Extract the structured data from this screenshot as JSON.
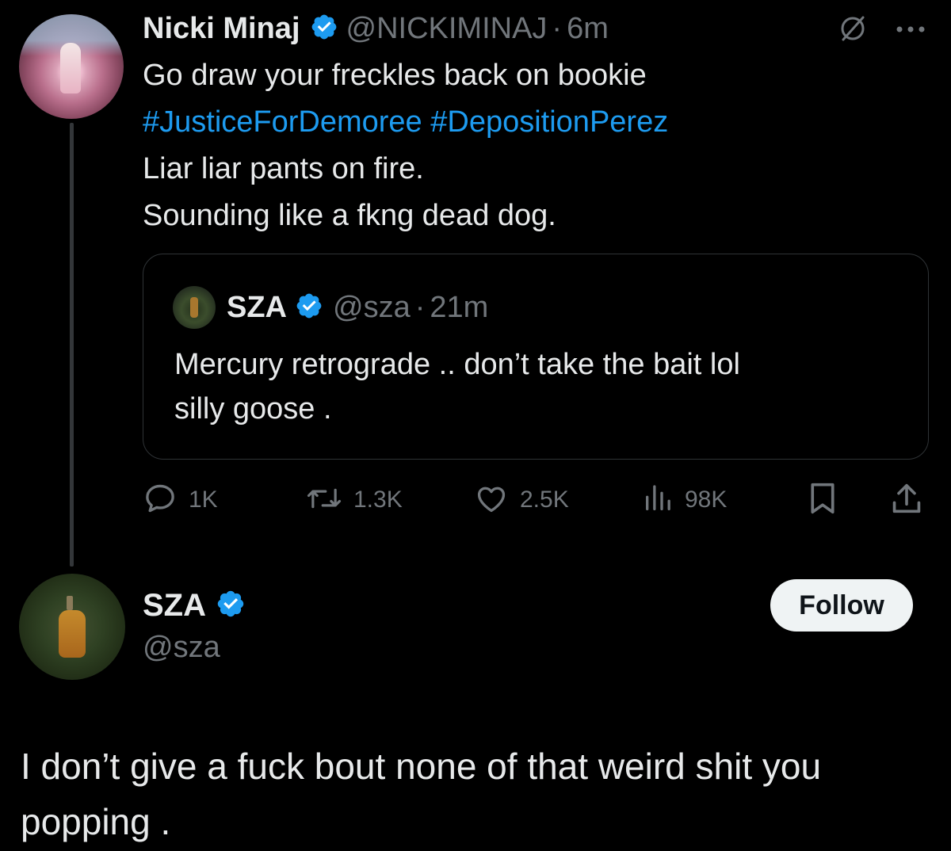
{
  "tweet": {
    "author_name": "Nicki Minaj",
    "author_handle": "@NICKIMINAJ",
    "separator": "·",
    "time": "6m",
    "text_lines": [
      "Go draw your freckles back on bookie",
      "Liar liar pants on fire.",
      "Sounding like a fkng dead dog."
    ],
    "hashtags": [
      "#JusticeForDemoree",
      "#DepositionPerez"
    ],
    "icons": [
      "grok-icon",
      "more-icon",
      "verified-badge-icon"
    ],
    "quote": {
      "author_name": "SZA",
      "author_handle": "@sza",
      "separator": "·",
      "time": "21m",
      "text_lines": [
        "Mercury retrograde .. don’t take the bait lol",
        "silly goose ."
      ]
    },
    "actions": {
      "replies": "1K",
      "reposts": "1.3K",
      "likes": "2.5K",
      "views": "98K"
    }
  },
  "reply": {
    "author_name": "SZA",
    "author_handle": "@sza",
    "follow_label": "Follow",
    "text_lines": [
      "I don’t give a fuck bout none of that weird shit you",
      "popping ."
    ]
  },
  "colors": {
    "background": "#000000",
    "text": "#e7e9ea",
    "secondary": "#71767b",
    "link": "#1d9bf0",
    "verified": "#1d9bf0",
    "border": "#2f3336"
  }
}
